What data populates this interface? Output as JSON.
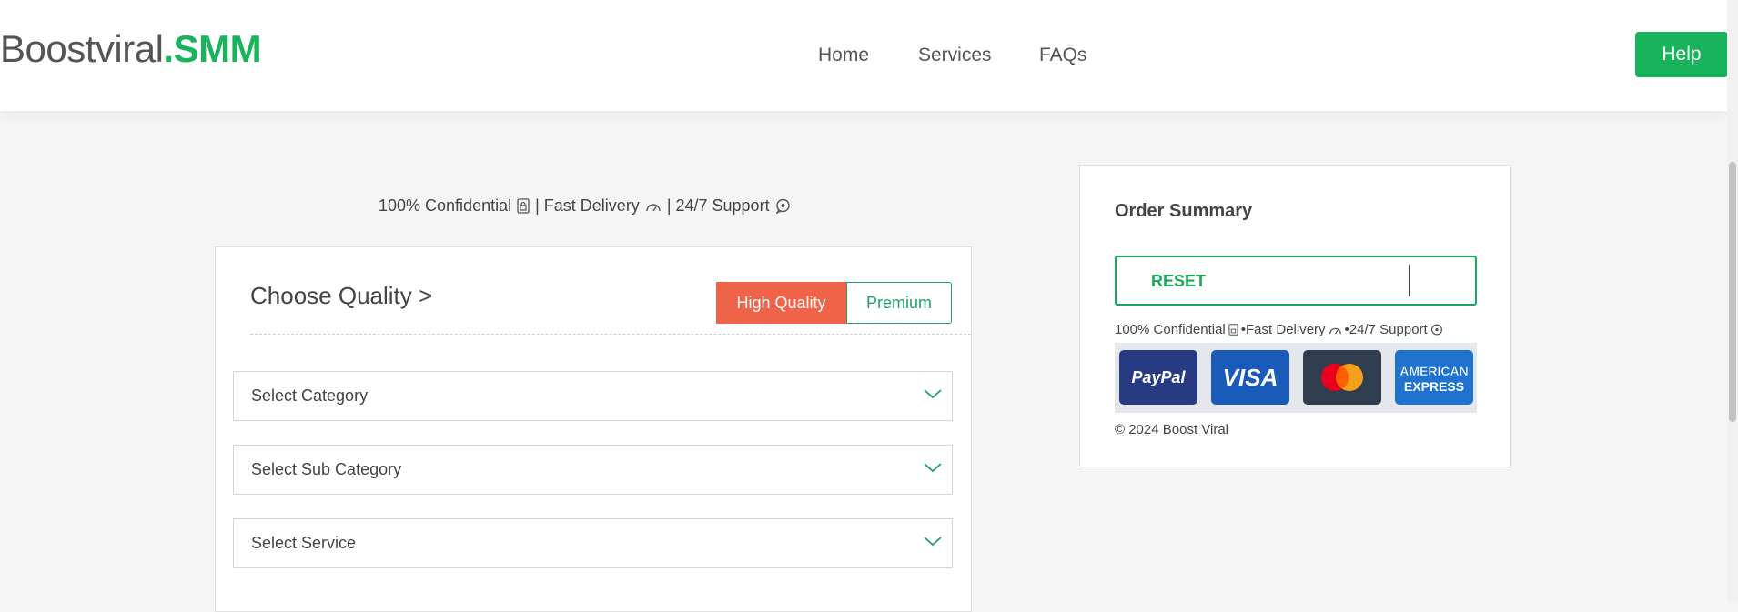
{
  "header": {
    "logo_part1": "Boostviral",
    "logo_part2": ".SMM",
    "nav": [
      "Home",
      "Services",
      "FAQs"
    ],
    "help_label": "Help"
  },
  "tagline": {
    "confidential": "100% Confidential",
    "sep1": "| Fast Delivery",
    "sep2": "| 24/7 Support"
  },
  "order_panel": {
    "title": "Choose Quality >",
    "quality_options": [
      "High Quality",
      "Premium"
    ],
    "selected_quality": "High Quality",
    "selects": [
      "Select Category",
      "Select Sub Category",
      "Select Service"
    ]
  },
  "summary": {
    "title": "Order Summary",
    "reset_label": "RESET",
    "tag_confidential": "100% Confidential",
    "tag_fast": "•Fast Delivery",
    "tag_support": "•24/7 Support",
    "payment_cards": [
      "PayPal",
      "VISA",
      "Mastercard",
      "AMERICAN EXPRESS"
    ],
    "copyright": "© 2024 Boost Viral"
  },
  "colors": {
    "brand_green": "#1ab35b",
    "quality_active": "#ef6448",
    "premium_outline": "#21a06a"
  }
}
